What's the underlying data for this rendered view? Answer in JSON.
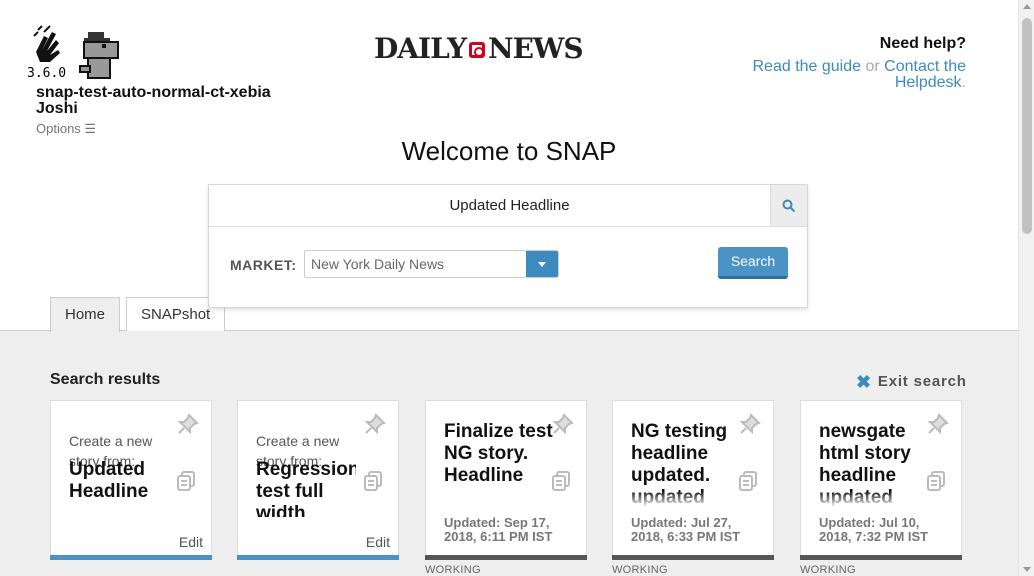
{
  "app": {
    "version": "3.6.0",
    "user_line1": "snap-test-auto-normal-ct-xebia",
    "user_line2": "Joshi",
    "options_label": "Options ☰",
    "brand_left": "DAILY",
    "brand_right": "NEWS"
  },
  "help": {
    "title": "Need help?",
    "guide_link": "Read the guide",
    "or": "or",
    "helpdesk_link": "Contact the Helpdesk",
    "period": "."
  },
  "welcome": "Welcome to SNAP",
  "search": {
    "query": "Updated Headline",
    "market_label": "MARKET:",
    "market_value": "New York Daily News",
    "submit_label": "Search"
  },
  "tabs": [
    {
      "label": "Home",
      "active": true
    },
    {
      "label": "SNAPshot",
      "active": false
    }
  ],
  "results": {
    "title": "Search results",
    "exit_label": "Exit search",
    "cards": [
      {
        "subtitle": "Create a new story from:",
        "headline": "Updated Headline",
        "edit": "Edit",
        "accent": "#4a93c4"
      },
      {
        "subtitle": "Create a new story from:",
        "headline": "Regression test full width",
        "edit": "Edit",
        "accent": "#4a93c4"
      },
      {
        "headline": "Finalize test NG story. Headline",
        "updated": "Updated: Sep 17, 2018, 6:11 PM IST",
        "status": "WORKING",
        "accent": "#555555"
      },
      {
        "headline": "NG testing headline updated. updated",
        "updated": "Updated: Jul 27, 2018, 6:33 PM IST",
        "status": "WORKING",
        "accent": "#555555"
      },
      {
        "headline": "newsgate html story headline updated",
        "updated": "Updated: Jul 10, 2018, 7:32 PM IST",
        "status": "WORKING",
        "accent": "#555555"
      }
    ]
  },
  "colors": {
    "accent": "#3b8bbe",
    "brand_red": "#d0021b",
    "background": "#eeeeee"
  }
}
